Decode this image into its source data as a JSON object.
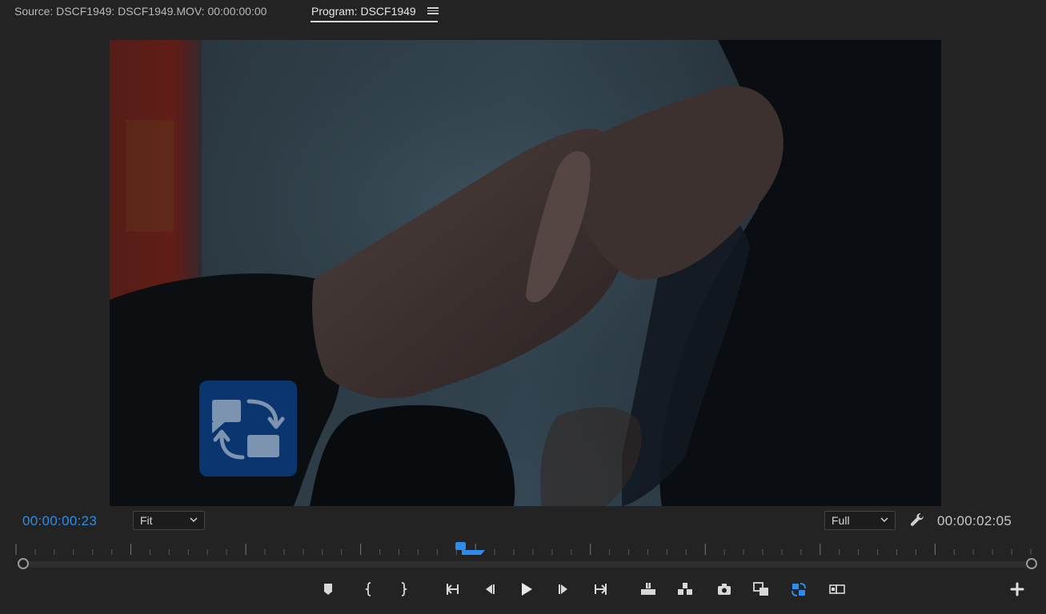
{
  "tabs": {
    "source_label": "Source: DSCF1949: DSCF1949.MOV: 00:00:00:00",
    "program_label": "Program: DSCF1949"
  },
  "timecode": {
    "current": "00:00:00:23",
    "duration": "00:00:02:05"
  },
  "zoom": {
    "selected": "Fit"
  },
  "resolution": {
    "selected": "Full"
  },
  "colors": {
    "accent": "#2d8ceb",
    "background": "#232323",
    "overlay_icon": "#0a3a78"
  },
  "transport_buttons": [
    "add-marker-icon",
    "mark-in-icon",
    "mark-out-icon",
    "go-to-in-icon",
    "step-back-icon",
    "play-icon",
    "step-forward-icon",
    "go-to-out-icon",
    "lift-icon",
    "extract-icon",
    "export-frame-icon",
    "comparison-view-icon",
    "toggle-proxies-icon",
    "vr-video-icon"
  ],
  "playhead_fraction": 0.434
}
